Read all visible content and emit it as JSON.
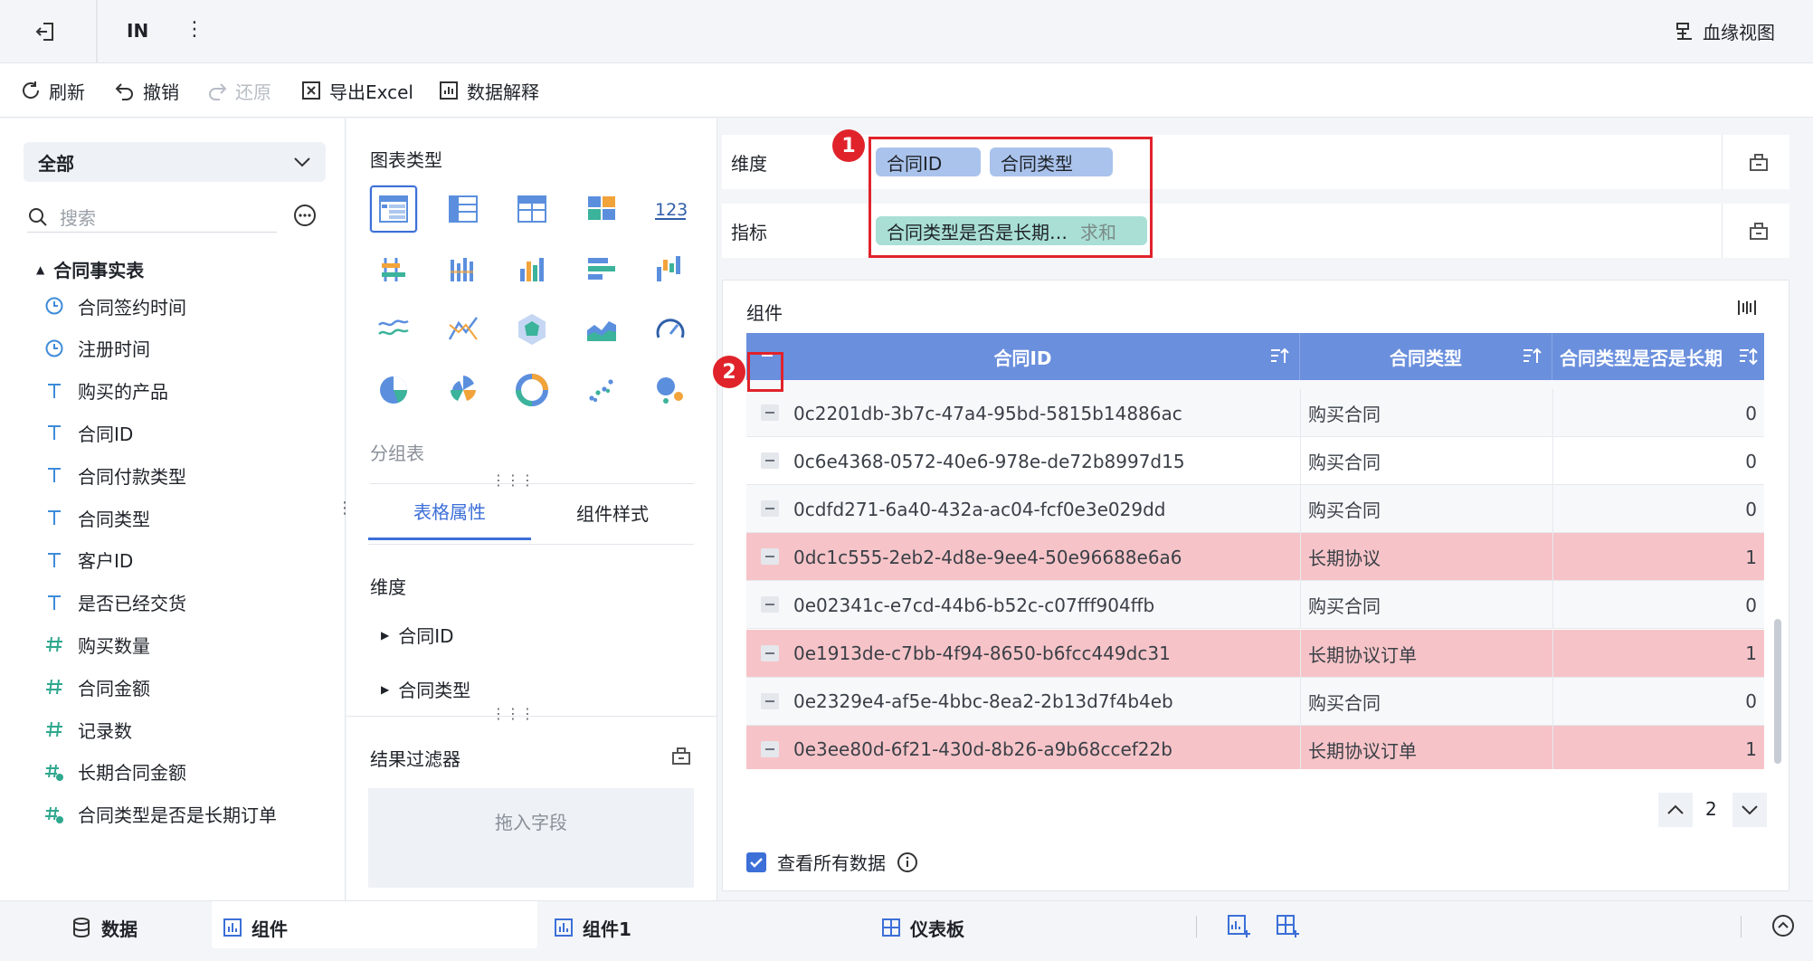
{
  "topbar": {
    "title": "IN",
    "lineage_label": "血缘视图"
  },
  "toolbar": {
    "refresh": "刷新",
    "undo": "撤销",
    "redo": "还原",
    "export": "导出Excel",
    "explain": "数据解释"
  },
  "left": {
    "dropdown_value": "全部",
    "search_placeholder": "搜索",
    "group_name": "合同事实表",
    "fields": [
      {
        "label": "合同签约时间",
        "icon": "clock-icon"
      },
      {
        "label": "注册时间",
        "icon": "clock-icon"
      },
      {
        "label": "购买的产品",
        "icon": "text-type-icon"
      },
      {
        "label": "合同ID",
        "icon": "text-type-icon"
      },
      {
        "label": "合同付款类型",
        "icon": "text-type-icon"
      },
      {
        "label": "合同类型",
        "icon": "text-type-icon"
      },
      {
        "label": "客户ID",
        "icon": "text-type-icon"
      },
      {
        "label": "是否已经交货",
        "icon": "text-type-icon"
      },
      {
        "label": "购买数量",
        "icon": "number-type-icon"
      },
      {
        "label": "合同金额",
        "icon": "number-type-icon"
      },
      {
        "label": "记录数",
        "icon": "number-type-icon"
      },
      {
        "label": "长期合同金额",
        "icon": "calc-number-icon"
      },
      {
        "label": "合同类型是否是长期订单",
        "icon": "calc-number-icon"
      }
    ]
  },
  "mid": {
    "chart_type_title": "图表类型",
    "current_chart_type": "分组表",
    "tab_table_props": "表格属性",
    "tab_component_style": "组件样式",
    "dimension_title": "维度",
    "dimension_items": [
      "合同ID",
      "合同类型"
    ],
    "result_filter_title": "结果过滤器",
    "drop_field_hint": "拖入字段"
  },
  "right": {
    "dimension_label": "维度",
    "dimension_pills": [
      "合同ID",
      "合同类型"
    ],
    "measure_label": "指标",
    "measure_pill": "合同类型是否是长期…",
    "measure_agg": "求和",
    "component_title": "组件",
    "badge1": "1",
    "badge2": "2",
    "table": {
      "headers": [
        "合同ID",
        "合同类型",
        "合同类型是否是长期"
      ],
      "rows": [
        {
          "id": "0c2201db-3b7c-47a4-95bd-5815b14886ac",
          "type": "购买合同",
          "value": "0",
          "highlight": false
        },
        {
          "id": "0c6e4368-0572-40e6-978e-de72b8997d15",
          "type": "购买合同",
          "value": "0",
          "highlight": false
        },
        {
          "id": "0cdfd271-6a40-432a-ac04-fcf0e3e029dd",
          "type": "购买合同",
          "value": "0",
          "highlight": false
        },
        {
          "id": "0dc1c555-2eb2-4d8e-9ee4-50e96688e6a6",
          "type": "长期协议",
          "value": "1",
          "highlight": true
        },
        {
          "id": "0e02341c-e7cd-44b6-b52c-c07fff904ffb",
          "type": "购买合同",
          "value": "0",
          "highlight": false
        },
        {
          "id": "0e1913de-c7bb-4f94-8650-b6fcc449dc31",
          "type": "长期协议订单",
          "value": "1",
          "highlight": true
        },
        {
          "id": "0e2329e4-af5e-4bbc-8ea2-2b13d7f4b4eb",
          "type": "购买合同",
          "value": "0",
          "highlight": false
        },
        {
          "id": "0e3ee80d-6f21-430d-8b26-a9b68ccef22b",
          "type": "长期协议订单",
          "value": "1",
          "highlight": true
        }
      ]
    },
    "page_number": "2",
    "view_all_label": "查看所有数据"
  },
  "bottom": {
    "data_tab": "数据",
    "tab_component": "组件",
    "tab_component1": "组件1",
    "tab_dashboard": "仪表板"
  },
  "colors": {
    "header_blue": "#6a8fdd",
    "highlight_red": "#f6c4c8",
    "badge_red": "#e0232b",
    "accent": "#3c6fd8"
  }
}
